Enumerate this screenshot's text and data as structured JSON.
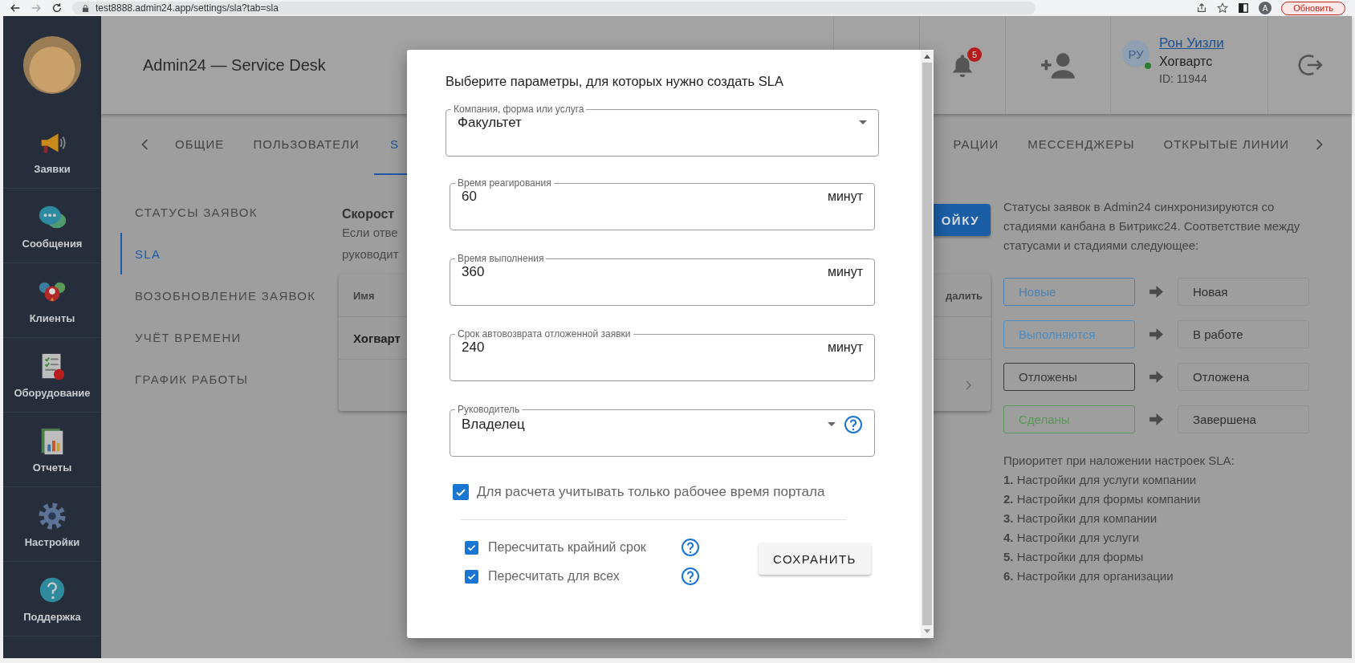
{
  "browser": {
    "url": "test8888.admin24.app/settings/sla?tab=sla",
    "profile_initial": "A",
    "update_button": "Обновить"
  },
  "sidebar": {
    "items": [
      {
        "label": "Заявки",
        "kind": "megaphone"
      },
      {
        "label": "Сообщения",
        "kind": "chat"
      },
      {
        "label": "Клиенты",
        "kind": "people"
      },
      {
        "label": "Оборудование",
        "kind": "checklist"
      },
      {
        "label": "Отчеты",
        "kind": "report"
      },
      {
        "label": "Настройки",
        "kind": "gear"
      },
      {
        "label": "Поддержка",
        "kind": "help"
      }
    ]
  },
  "header": {
    "title": "Admin24 — Service Desk",
    "notifications": "5",
    "user": {
      "initials": "РУ",
      "online": true,
      "name": "Рон Уизли",
      "org": "Хогвартс",
      "id": "ID: 11944"
    }
  },
  "tabs_start": [
    {
      "label": "ОБЩИЕ",
      "selected": false
    },
    {
      "label": "ПОЛЬЗОВАТЕЛИ",
      "selected": false
    },
    {
      "label": "S",
      "selected": true
    }
  ],
  "tabs_end": [
    {
      "label": "РАЦИИ",
      "selected": false
    },
    {
      "label": "МЕССЕНДЖЕРЫ",
      "selected": false
    },
    {
      "label": "ОТКРЫТЫЕ ЛИНИИ",
      "selected": false
    }
  ],
  "settings_nav": [
    {
      "label": "СТАТУСЫ ЗАЯВОК",
      "selected": false
    },
    {
      "label": "SLA",
      "selected": true
    },
    {
      "label": "ВОЗОБНОВЛЕНИЕ ЗАЯВОК",
      "selected": false
    },
    {
      "label": "УЧЁТ ВРЕМЕНИ",
      "selected": false
    },
    {
      "label": "ГРАФИК РАБОТЫ",
      "selected": false
    }
  ],
  "sla_section": {
    "heading": "Скорост",
    "text_lines": [
      "Если отве",
      "руководит"
    ],
    "button": "ОЙКУ",
    "table": {
      "columns": [
        "Имя",
        "далить"
      ],
      "rows": [
        [
          "Хогварт"
        ]
      ]
    }
  },
  "status_panel": {
    "intro": "Статусы заявок в Admin24 синхронизируются со стадиями канбана в Битрикс24. Соответствие между статусами и стадиями следующее:",
    "mappings": [
      {
        "status": "Новые",
        "color": "#4f80b5",
        "stage": "Новая"
      },
      {
        "status": "Выполняются",
        "color": "#4d8cbf",
        "stage": "В работе"
      },
      {
        "status": "Отложены",
        "color": "#3a3a3a",
        "stage": "Отложена"
      },
      {
        "status": "Сделаны",
        "color": "#5a9657",
        "stage": "Завершена"
      }
    ],
    "priority_title": "Приоритет при наложении настроек SLA:",
    "priority": [
      "**1.** Настройки для услуги компании",
      "**2.** Настройки для формы компании",
      "**3.** Настройки для компании",
      "**4.** Настройки для услуги",
      "**5.** Настройки для формы",
      "**6.** Настройки для организации"
    ]
  },
  "dialog": {
    "title": "Выберите параметры, для которых нужно создать SLA",
    "fields": [
      {
        "kind": "select",
        "label": "Компания, форма или услуга",
        "value": "Факультет",
        "help": false
      },
      {
        "kind": "number",
        "label": "Время реагирования",
        "value": "60",
        "unit": "минут",
        "help": false
      },
      {
        "kind": "number",
        "label": "Время выполнения",
        "value": "360",
        "unit": "минут",
        "help": false
      },
      {
        "kind": "number",
        "label": "Срок автовозврата отложенной заявки",
        "value": "240",
        "unit": "минут",
        "help": false
      },
      {
        "kind": "select",
        "label": "Руководитель",
        "value": "Владелец",
        "help": true
      }
    ],
    "work_time": {
      "label": "Для расчета учитывать только рабочее время портала",
      "checked": true
    },
    "options": [
      {
        "label": "Пересчитать крайний срок",
        "checked": true,
        "help": true
      },
      {
        "label": "Пересчитать для всех",
        "checked": true,
        "help": true
      }
    ],
    "save_button": "СОХРАНИТЬ"
  }
}
